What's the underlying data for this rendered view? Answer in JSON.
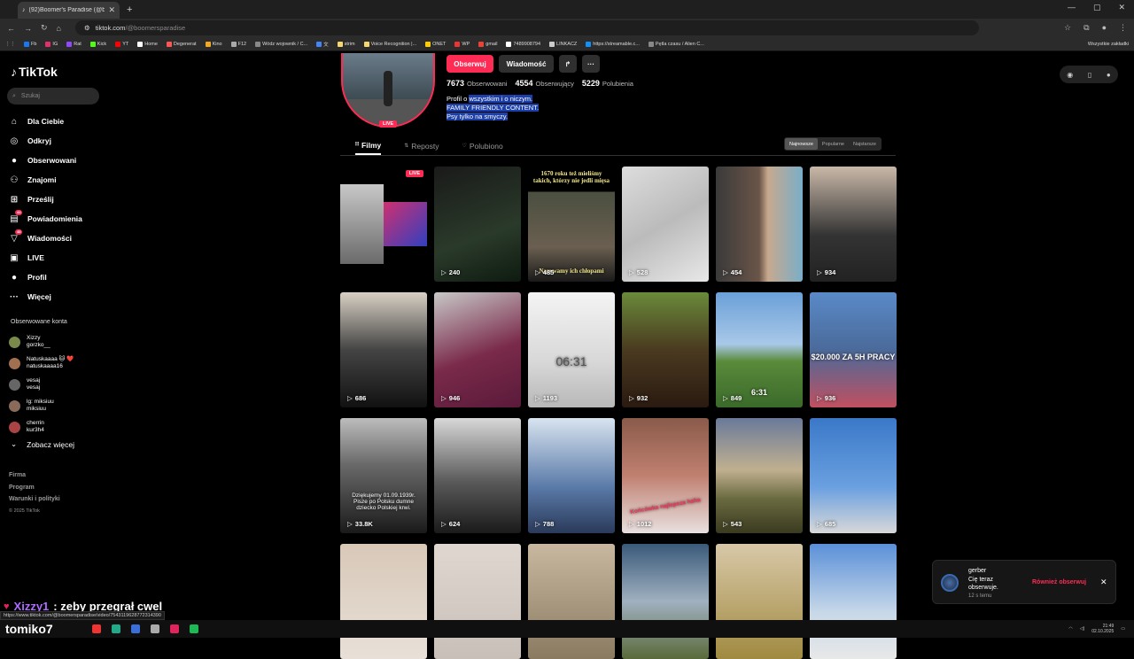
{
  "browser": {
    "tab_title": "(92)Boomer's Paradise (@boom",
    "tab_close": "✕",
    "new_tab": "+",
    "url_host": "tiktok.com",
    "url_path": "/@boomersparadise",
    "window_controls": [
      "—",
      "▢",
      "✕"
    ],
    "bookmarks": [
      {
        "label": "Fb",
        "color": "#1877f2"
      },
      {
        "label": "IG",
        "color": "#e1306c"
      },
      {
        "label": "Rat",
        "color": "#9146ff"
      },
      {
        "label": "Kick",
        "color": "#53fc18"
      },
      {
        "label": "YT",
        "color": "#ff0000"
      },
      {
        "label": "Home",
        "color": "#ffffff"
      },
      {
        "label": "Degenerat",
        "color": "#ff5555"
      },
      {
        "label": "Kino",
        "color": "#f5a623"
      },
      {
        "label": "F12",
        "color": "#aaaaaa"
      },
      {
        "label": "Wódz wojownik / C...",
        "color": "#888888"
      },
      {
        "label": "文",
        "color": "#4285f4"
      },
      {
        "label": "strim",
        "color": "#f5d76e"
      },
      {
        "label": "Voice Recognition |...",
        "color": "#f5d76e"
      },
      {
        "label": "ONET",
        "color": "#ffcc00"
      },
      {
        "label": "WP",
        "color": "#e33"
      },
      {
        "label": "gmail",
        "color": "#ea4335"
      },
      {
        "label": "7489908794",
        "color": "#ffffff"
      },
      {
        "label": "LINKACZ",
        "color": "#cccccc"
      },
      {
        "label": "https://streamable.c...",
        "color": "#0f90fa"
      },
      {
        "label": "Pętla czasu / Alien C...",
        "color": "#888888"
      }
    ],
    "bookmarks_right": "Wszystkie zakładki"
  },
  "sidebar": {
    "logo": "TikTok",
    "search_placeholder": "Szukaj",
    "nav": [
      {
        "label": "Dla Ciebie",
        "icon": "home-icon",
        "glyph": "⌂",
        "badge": ""
      },
      {
        "label": "Odkryj",
        "icon": "compass-icon",
        "glyph": "◎",
        "badge": ""
      },
      {
        "label": "Obserwowani",
        "icon": "avatar-icon",
        "glyph": "●",
        "badge": ""
      },
      {
        "label": "Znajomi",
        "icon": "friends-icon",
        "glyph": "⚇",
        "badge": ""
      },
      {
        "label": "Prześlij",
        "icon": "upload-icon",
        "glyph": "⊞",
        "badge": ""
      },
      {
        "label": "Powiadomienia",
        "icon": "bell-icon",
        "glyph": "▤",
        "badge": "44"
      },
      {
        "label": "Wiadomości",
        "icon": "message-icon",
        "glyph": "▽",
        "badge": "48"
      },
      {
        "label": "LIVE",
        "icon": "live-icon",
        "glyph": "▣",
        "badge": ""
      },
      {
        "label": "Profil",
        "icon": "profile-icon",
        "glyph": "●",
        "badge": ""
      },
      {
        "label": "Więcej",
        "icon": "more-icon",
        "glyph": "···",
        "badge": ""
      }
    ],
    "following_title": "Obserwowane konta",
    "following": [
      {
        "name": "Xizzy",
        "handle": "gorzko__",
        "color": "#7a8a4a"
      },
      {
        "name": "Natuskaaaa 🐱 ❤️",
        "handle": "natuskaaaa16",
        "color": "#a07050"
      },
      {
        "name": "vesaj",
        "handle": "vesaj",
        "color": "#666666"
      },
      {
        "name": "lg: miksiuu",
        "handle": "miksiuu",
        "color": "#8a6a5a"
      },
      {
        "name": "cherrin",
        "handle": "kur3h4",
        "color": "#aa4444"
      }
    ],
    "see_more": "Zobacz więcej",
    "footer": [
      "Firma",
      "Program",
      "Warunki i polityki"
    ],
    "copyright": "© 2025 TikTok"
  },
  "profile": {
    "live_badge": "LIVE",
    "follow_btn": "Obserwuj",
    "message_btn": "Wiadomość",
    "stats": [
      {
        "value": "7673",
        "label": "Obserwowani"
      },
      {
        "value": "4554",
        "label": "Obserwujący"
      },
      {
        "value": "5229",
        "label": "Polubienia"
      }
    ],
    "bio_prefix": "Profil o ",
    "bio_line1_hl": "wszystkim i o niczym.",
    "bio_line2": "FAMILY FRIENDLY CONTENT.",
    "bio_line3": "Psy tylko na smyczy."
  },
  "tabs": [
    {
      "label": "Filmy",
      "icon": "grid-icon",
      "glyph": "⦙⦙⦙"
    },
    {
      "label": "Reposty",
      "icon": "repost-icon",
      "glyph": "⇅"
    },
    {
      "label": "Polubiono",
      "icon": "heart-icon",
      "glyph": "♡"
    }
  ],
  "sort_options": [
    "Najnowsze",
    "Popularne",
    "Najstarsze"
  ],
  "videos": [
    {
      "views": "",
      "live": "LIVE",
      "bg": "linear-gradient(90deg,#000 0%,#000 100%)",
      "overlay": "",
      "kind": "live"
    },
    {
      "views": "240",
      "bg": "linear-gradient(160deg,#1a1a1a,#2a3a2a 60%,#0e1a10)",
      "overlay": ""
    },
    {
      "views": "485",
      "bg": "linear-gradient(#000 0%,#000 22%,#4a4f40 22%,#6a5f50 70%,#1a1a1a)",
      "overlay": "1670 roku też mieliśmy takich, którzy nie jedli mięsa",
      "overlay2": "Nazywamy ich chłopami"
    },
    {
      "views": "528",
      "bg": "linear-gradient(150deg,#ddd,#bbb 50%,#e8e8e8)",
      "overlay": ""
    },
    {
      "views": "454",
      "bg": "linear-gradient(90deg,#3a3a3a 0%,#6a5548 50%,#c7a98e 60%,#7aaec8 100%)",
      "overlay": ""
    },
    {
      "views": "934",
      "bg": "linear-gradient(#c9b8a8,#333 60%,#222)",
      "overlay": ""
    },
    {
      "views": "686",
      "bg": "linear-gradient(#d8d0c4,#444 50%,#111)",
      "overlay": ""
    },
    {
      "views": "946",
      "bg": "linear-gradient(160deg,#c8c8c8,#7a2a4a 55%,#5a1a3a)",
      "overlay": ""
    },
    {
      "views": "1193",
      "bg": "linear-gradient(#f4f4f4,#d8d8d8 60%,#b8b8b8)",
      "overlay": "06:31"
    },
    {
      "views": "932",
      "bg": "linear-gradient(#6a8a3a,#4a3a20 50%,#2a1a10)",
      "overlay": ""
    },
    {
      "views": "849",
      "bg": "linear-gradient(#6ba0d8 0%,#a8c8e8 45%,#5a8a3a 60%,#3a6a2a)",
      "overlay": "6:31"
    },
    {
      "views": "936",
      "bg": "linear-gradient(#5a8ac8,#4a6a9a 50%,#c05060)",
      "overlay": "$20.000 ZA 5H PRACY"
    },
    {
      "views": "33.8K",
      "bg": "linear-gradient(#bdbdbd,#6a6a6a 40%,#1a1a1a)",
      "overlay": "Dziękujemy 01.09.1939r. Pisze po Polsku dumne dziecko Polskiej krwi."
    },
    {
      "views": "624",
      "bg": "linear-gradient(#d8d8d8,#5a5a5a 55%,#1a1a1a)",
      "overlay": ""
    },
    {
      "views": "788",
      "bg": "linear-gradient(#d8e4f0,#5a7aa8 60%,#2a3a5a)",
      "overlay": ""
    },
    {
      "views": "1012",
      "bg": "linear-gradient(#8a5a4a,#c08070 50%,#e8e0e0)",
      "overlay": "Końcówka najlepsza haha"
    },
    {
      "views": "543",
      "bg": "linear-gradient(#6a7a9a,#c0b090 45%,#6a6a40 70%,#3a3a20)",
      "overlay": ""
    },
    {
      "views": "685",
      "bg": "linear-gradient(#3a78c8,#6aa0e0 60%,#d8d8d8)",
      "overlay": ""
    },
    {
      "views": "",
      "bg": "linear-gradient(#d8c8b8,#e8e0d8)",
      "overlay": ""
    },
    {
      "views": "",
      "bg": "linear-gradient(#e0d8d0,#c8c0b8)",
      "overlay": ""
    },
    {
      "views": "",
      "bg": "linear-gradient(#c8b8a0,#8a7a60)",
      "overlay": ""
    },
    {
      "views": "",
      "bg": "linear-gradient(#3a5a7a,#a0b0c0 50%,#5a6a3a)",
      "overlay": ""
    },
    {
      "views": "",
      "bg": "linear-gradient(#d8c8a8,#a08a40)",
      "overlay": ""
    },
    {
      "views": "",
      "bg": "linear-gradient(#5a90d8,#c8d8e8 60%,#e8e8e8)",
      "overlay": ""
    }
  ],
  "toast": {
    "name": "gerber",
    "message_1": "Cię teraz",
    "message_2": "obserwuje.",
    "time": "12 s temu",
    "action": "Również obserwuj",
    "close": "✕"
  },
  "overlay": {
    "chat_user": "Xizzy1",
    "chat_text": ": zeby przegrał cwel",
    "status_url": "https://www.tiktok.com/@boomersparadise/video/7543119628772314390",
    "streamer": "tomiko7"
  },
  "taskbar": {
    "time": "21:49",
    "date": "02.10.2025",
    "icons": [
      "#e33",
      "#2a8",
      "#3a6fd8",
      "#aaa",
      "#e0245e",
      "#1db954"
    ]
  }
}
